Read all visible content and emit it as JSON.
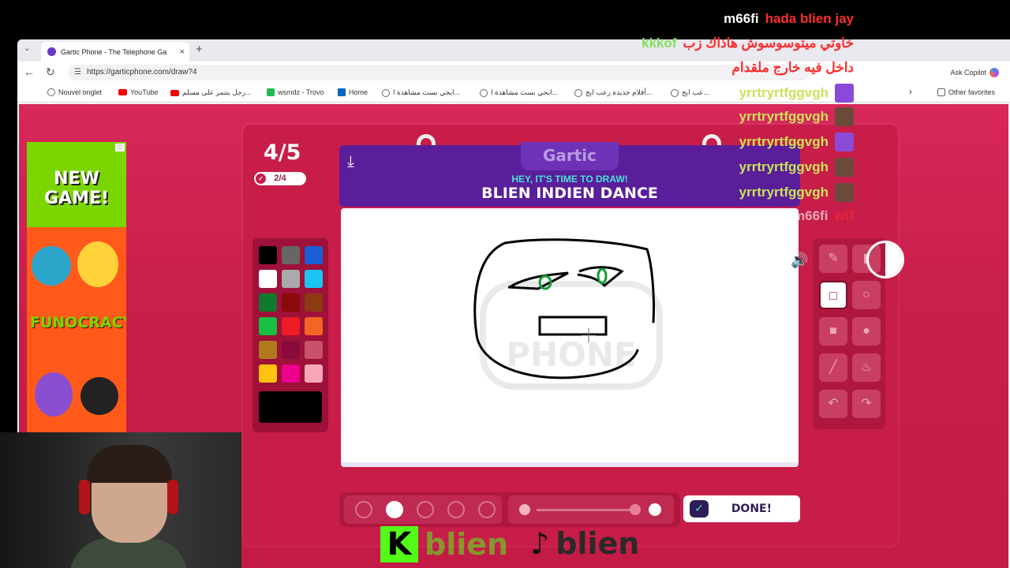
{
  "browser": {
    "tab_title": "Gartic Phone - The Telephone Ga",
    "url": "https://garticphone.com/draw?4",
    "ask_copilot": "Ask Copilot",
    "bookmarks": [
      "Nouvel onglet",
      "YouTube",
      "رجل يتنمر على مسلم...",
      "wsmdz - Trovo",
      "Home",
      "ايجي بست مشاهدة ا...",
      "ايجي بست مشاهدة ا...",
      "أفلام جديدة رعب ايج...",
      "عب ايج...",
      "Other favorites"
    ]
  },
  "ad": {
    "headline": "NEW GAME!",
    "brand": "FUNOCRACY"
  },
  "game": {
    "round": "4/5",
    "progress": "2/4",
    "logo": "Gartic",
    "prompt_sub": "HEY, IT'S TIME TO DRAW!",
    "prompt_word": "BLIEN INDIEN DANCE",
    "done_label": "DONE!",
    "colors": [
      "#000000",
      "#666666",
      "#1a5fd6",
      "#ffffff",
      "#aaaaaa",
      "#1cc4f2",
      "#0f7a2e",
      "#8b0a0a",
      "#8a3b12",
      "#16c043",
      "#ee1c24",
      "#f26522",
      "#b07a1c",
      "#8b0a3c",
      "#c8526a",
      "#ffc20e",
      "#ec008c",
      "#f6a6b8"
    ],
    "selected_color": "#000000",
    "brush_sizes": 5,
    "selected_brush_size": 2,
    "tools": [
      "pencil-icon",
      "eraser-icon",
      "rectangle-outline-icon",
      "ellipse-outline-icon",
      "rectangle-filled-icon",
      "ellipse-filled-icon",
      "line-icon",
      "bucket-icon",
      "undo-icon",
      "redo-icon"
    ],
    "selected_tool": "rectangle-outline-icon"
  },
  "chat": [
    {
      "user": "m66fi",
      "text": "hada blien jay",
      "user_color": "#ffffff"
    },
    {
      "user": "kkkof",
      "text": "خاوتي ميتوسوسوش هاذاك زب",
      "user_color": "#7fe05a"
    },
    {
      "user": "",
      "text": "داخل فيه خارج ملقدام",
      "user_color": "#ffffff"
    },
    {
      "user": "yrrtryrtfggvgh",
      "text": "",
      "user_color": "#c9e35a"
    },
    {
      "user": "yrrtryrtfggvgh",
      "text": "",
      "user_color": "#c9e35a"
    },
    {
      "user": "yrrtryrtfggvgh",
      "text": "",
      "user_color": "#c9e35a"
    },
    {
      "user": "yrrtryrtfggvgh",
      "text": "",
      "user_color": "#c9e35a"
    },
    {
      "user": "yrrtryrtfggvgh",
      "text": "",
      "user_color": "#c9e35a"
    },
    {
      "user": "m66fi",
      "text": "wtf",
      "user_color": "#ffffff"
    }
  ],
  "socials": {
    "kick": "blien",
    "tiktok": "blien"
  }
}
